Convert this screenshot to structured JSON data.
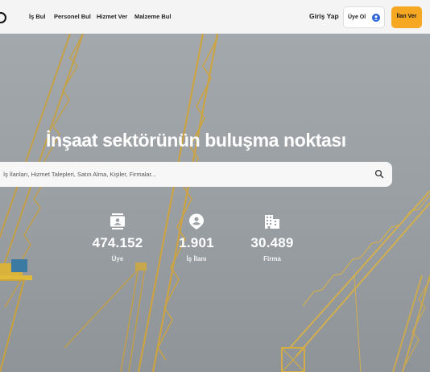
{
  "header": {
    "nav": [
      {
        "label": "İş Bul"
      },
      {
        "label": "Personel Bul"
      },
      {
        "label": "Hizmet Ver"
      },
      {
        "label": "Malzeme Bul"
      }
    ],
    "login_label": "Giriş Yap",
    "signup_label": "Üye Ol",
    "post_ad_label": "İlan Ver"
  },
  "hero": {
    "headline": "İnşaat sektörünün buluşma noktası",
    "search": {
      "placeholder": "İş İlanları, Hizmet Talepleri, Satın Alma, Kişiler, Firmalar...",
      "value": ""
    },
    "stats": [
      {
        "icon": "contact-card-icon",
        "value": "474.152",
        "label": "Üye"
      },
      {
        "icon": "person-pin-icon",
        "value": "1.901",
        "label": "İş İlanı"
      },
      {
        "icon": "building-icon",
        "value": "30.489",
        "label": "Firma"
      }
    ]
  },
  "colors": {
    "accent": "#f7a823",
    "header_bg": "#f4f4f4",
    "user_icon": "#2962d9"
  }
}
